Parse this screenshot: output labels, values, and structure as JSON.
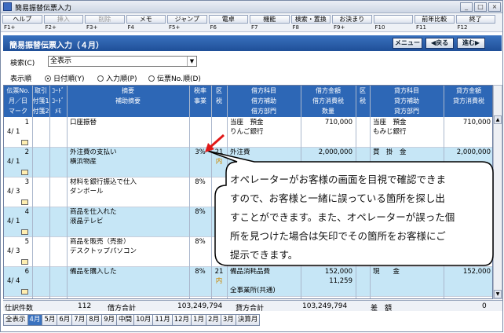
{
  "window": {
    "title": "簡易振替伝票入力"
  },
  "fkeys": [
    {
      "label": "ヘルプ",
      "key": "F1+",
      "enabled": true
    },
    {
      "label": "挿入",
      "key": "F2+",
      "enabled": false
    },
    {
      "label": "削除",
      "key": "F3+",
      "enabled": false
    },
    {
      "label": "メモ",
      "key": "F4",
      "enabled": true
    },
    {
      "label": "ジャンプ",
      "key": "F5+",
      "enabled": true
    },
    {
      "label": "電卓",
      "key": "F6",
      "enabled": true
    },
    {
      "label": "機能",
      "key": "F7",
      "enabled": true
    },
    {
      "label": "検索・置換",
      "key": "F8",
      "enabled": true
    },
    {
      "label": "お決まり",
      "key": "F9+",
      "enabled": true
    },
    {
      "label": "",
      "key": "F10",
      "enabled": true
    },
    {
      "label": "前年比較",
      "key": "F11",
      "enabled": true
    },
    {
      "label": "終了",
      "key": "F12",
      "enabled": true
    }
  ],
  "header": {
    "title": "簡易振替伝票入力（４月）",
    "menu": "メニュー",
    "back": "◀戻る",
    "next": "進む▶"
  },
  "search": {
    "label": "検索(C)",
    "value": "全表示"
  },
  "order": {
    "label": "表示順",
    "options": [
      "日付順(Y)",
      "入力順(P)",
      "伝票No.順(D)"
    ],
    "selected": 0
  },
  "columns": {
    "c1": [
      "伝票No.",
      "月／日",
      "マーク"
    ],
    "c2": [
      "取引",
      "付箋1",
      "付箋2"
    ],
    "c3": [
      "ｺｰﾄﾞ",
      "ｺｰﾄﾞ",
      "ﾒﾓ"
    ],
    "c4": [
      "摘要",
      "補助摘要",
      ""
    ],
    "c5": [
      "税率",
      "事業",
      ""
    ],
    "c6": [
      "区",
      "税",
      ""
    ],
    "c7": [
      "借方科目",
      "借方補助",
      "借方部門"
    ],
    "c8": [
      "借方金額",
      "借方消費税",
      "数量"
    ],
    "c9": [
      "区",
      "税",
      ""
    ],
    "c10": [
      "貸方科目",
      "貸方補助",
      "貸方部門"
    ],
    "c11": [
      "貸方金額",
      "貸方消費税",
      ""
    ]
  },
  "rows": [
    {
      "no": "1",
      "date": "4/ 1",
      "summary": "口座振替",
      "sub": "",
      "tax": "",
      "ku": "",
      "zei": "",
      "debit": "当座　預金",
      "debit_sub": "りんご銀行",
      "dr_amt": "710,000",
      "dr_tax": "",
      "credit": "当座　預金",
      "credit_sub": "もみじ銀行",
      "cr_amt": "710,000",
      "cr_tax": ""
    },
    {
      "no": "2",
      "date": "4/ 1",
      "summary": "外注費の支払い",
      "sub": "横浜物産",
      "tax": "3%",
      "ku": "21",
      "zei": "内",
      "debit": "外注費",
      "debit_sub": "",
      "dr_amt": "2,000,000",
      "dr_tax": "",
      "credit": "買　掛　金",
      "credit_sub": "",
      "cr_amt": "2,000,000",
      "cr_tax": ""
    },
    {
      "no": "3",
      "date": "4/ 3",
      "summary": "材料を銀行振込で仕入",
      "sub": "ダンボール",
      "tax": "8%",
      "ku": "",
      "zei": "",
      "debit": "",
      "debit_sub": "",
      "dr_amt": "",
      "dr_tax": "",
      "credit": "",
      "credit_sub": "",
      "cr_amt": "",
      "cr_tax": ""
    },
    {
      "no": "4",
      "date": "4/ 1",
      "summary": "商品を仕入れた",
      "sub": "液晶テレビ",
      "tax": "8%",
      "ku": "",
      "zei": "",
      "debit": "",
      "debit_sub": "",
      "dr_amt": "",
      "dr_tax": "",
      "credit": "",
      "credit_sub": "",
      "cr_amt": "",
      "cr_tax": ""
    },
    {
      "no": "5",
      "date": "4/ 3",
      "summary": "商品を販売（売掛）",
      "sub": "デスクトップパソコン",
      "tax": "8%",
      "ku": "",
      "zei": "",
      "debit": "",
      "debit_sub": "",
      "dr_amt": "",
      "dr_tax": "",
      "credit": "",
      "credit_sub": "",
      "cr_amt": "",
      "cr_tax": ""
    },
    {
      "no": "6",
      "date": "4/ 4",
      "summary": "備品を購入した",
      "sub": "",
      "tax": "8%",
      "ku": "21",
      "zei": "内",
      "debit": "備品消耗品費",
      "debit_sub": "",
      "debit_dept": "全事業所(共通)",
      "dr_amt": "152,000",
      "dr_tax": "11,259",
      "credit": "現　　金",
      "credit_sub": "",
      "cr_amt": "152,000",
      "cr_tax": ""
    }
  ],
  "footer": {
    "count_label": "仕訳件数",
    "count": "112",
    "debit_label": "借方合計",
    "debit_total": "103,249,794",
    "credit_label": "貸方合計",
    "credit_total": "103,249,794",
    "diff_label": "差　額",
    "diff": "0"
  },
  "tabs": [
    "全表示",
    "4月",
    "5月",
    "6月",
    "7月",
    "8月",
    "9月",
    "中間",
    "10月",
    "11月",
    "12月",
    "1月",
    "2月",
    "3月",
    "決算月"
  ],
  "active_tab": 1,
  "callout": [
    "オペレーターがお客様の画面を目視で確認できま",
    "すので、お客様と一緒に誤っている箇所を探し出",
    "すことができます。また、オペレーターが誤った個",
    "所を見つけた場合は矢印でその箇所をお客様にご",
    "提示できます。"
  ]
}
